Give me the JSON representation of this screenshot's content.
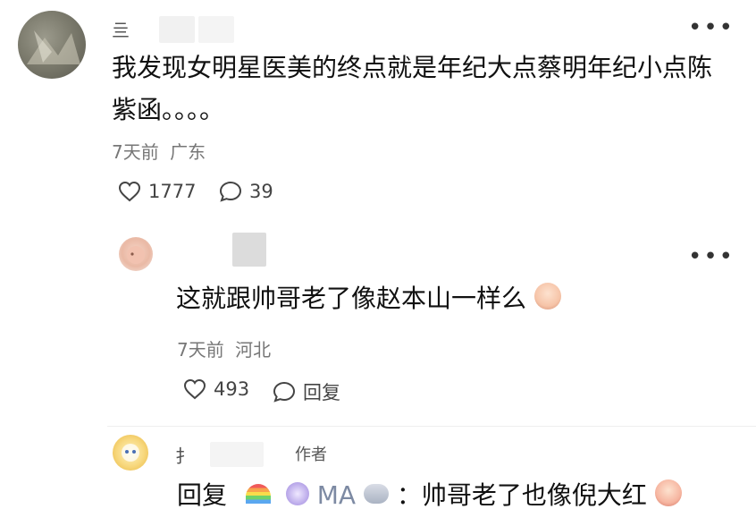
{
  "comments": [
    {
      "username": "亖      ",
      "text_line1": "我发现女明星医美的终点就是年纪大点蔡明年纪小点陈",
      "text_line2": "紫函。。。。",
      "time": "7天前",
      "location": "广东",
      "likes": "1777",
      "replies": "39"
    },
    {
      "text": "这就跟帅哥老了像赵本山一样么",
      "time": "7天前",
      "location": "河北",
      "likes": "493",
      "reply_label": "回复"
    },
    {
      "username": "扌",
      "author_badge": "作者",
      "reply_prefix": "回复",
      "reply_to": "MA",
      "text": "：帅哥老了也像倪大红"
    }
  ]
}
